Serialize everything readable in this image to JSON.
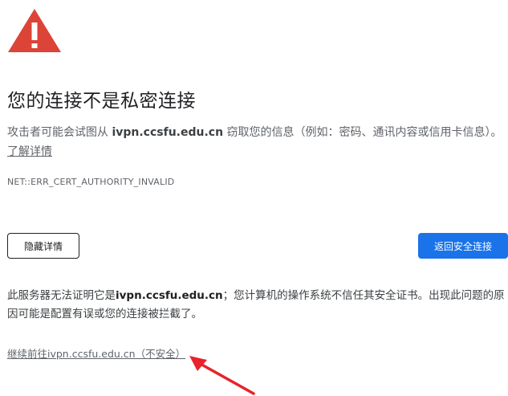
{
  "icons": {
    "warning": "warning-triangle-icon",
    "annotation_arrow": "red-arrow-icon"
  },
  "colors": {
    "warning_red": "#db4437",
    "primary_blue": "#1a73e8",
    "arrow_red": "#e8232b"
  },
  "heading": "您的连接不是私密连接",
  "description": {
    "prefix": "攻击者可能会试图从 ",
    "domain": "ivpn.ccsfu.edu.cn",
    "suffix": " 窃取您的信息（例如：密码、通讯内容或信用卡信息）。",
    "learn_more": "了解详情"
  },
  "error_code": "NET::ERR_CERT_AUTHORITY_INVALID",
  "buttons": {
    "hide_details": "隐藏详情",
    "back_to_safety": "返回安全连接"
  },
  "details": {
    "prefix": "此服务器无法证明它是",
    "domain": "ivpn.ccsfu.edu.cn",
    "suffix": "；您计算机的操作系统不信任其安全证书。出现此问题的原因可能是配置有误或您的连接被拦截了。"
  },
  "proceed_link": "继续前往ivpn.ccsfu.edu.cn（不安全）"
}
